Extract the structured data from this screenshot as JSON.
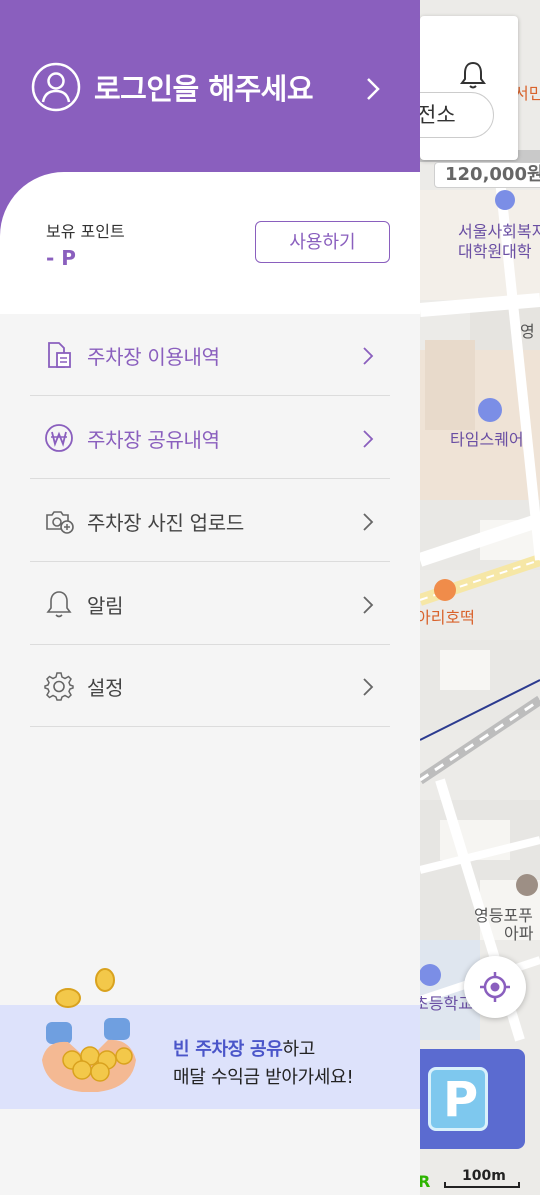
{
  "drawer": {
    "login_prompt": "로그인을 해주세요",
    "points": {
      "label": "보유 포인트",
      "value": "- P",
      "use_button": "사용하기"
    },
    "menu": [
      {
        "label": "주차장 이용내역",
        "icon": "document-icon",
        "highlighted": true
      },
      {
        "label": "주차장 공유내역",
        "icon": "won-icon",
        "highlighted": true
      },
      {
        "label": "주차장 사진 업로드",
        "icon": "camera-icon",
        "highlighted": false
      },
      {
        "label": "알림",
        "icon": "bell-icon",
        "highlighted": false
      },
      {
        "label": "설정",
        "icon": "gear-icon",
        "highlighted": false
      }
    ],
    "banner": {
      "highlight": "빈 주차장 공유",
      "line1_rest": "하고",
      "line2": "매달 수익금 받아가세요!"
    }
  },
  "map": {
    "station_pill": "전소",
    "price_tag": "120,000원",
    "labels": {
      "welfare_school": "서울사회복지",
      "welfare_school_2": "대학원대학",
      "times_square": "타임스퀘어",
      "yeong": "영",
      "restaurant": "아리호떡",
      "apartment": "영등포푸",
      "apartment_2": "아파",
      "school": "초등학교",
      "top_right": "서민"
    },
    "scale": "100m"
  },
  "colors": {
    "brand_purple": "#8a5fbe",
    "banner_bg": "#dde2fb",
    "parking_blue": "#5b6bd0"
  }
}
